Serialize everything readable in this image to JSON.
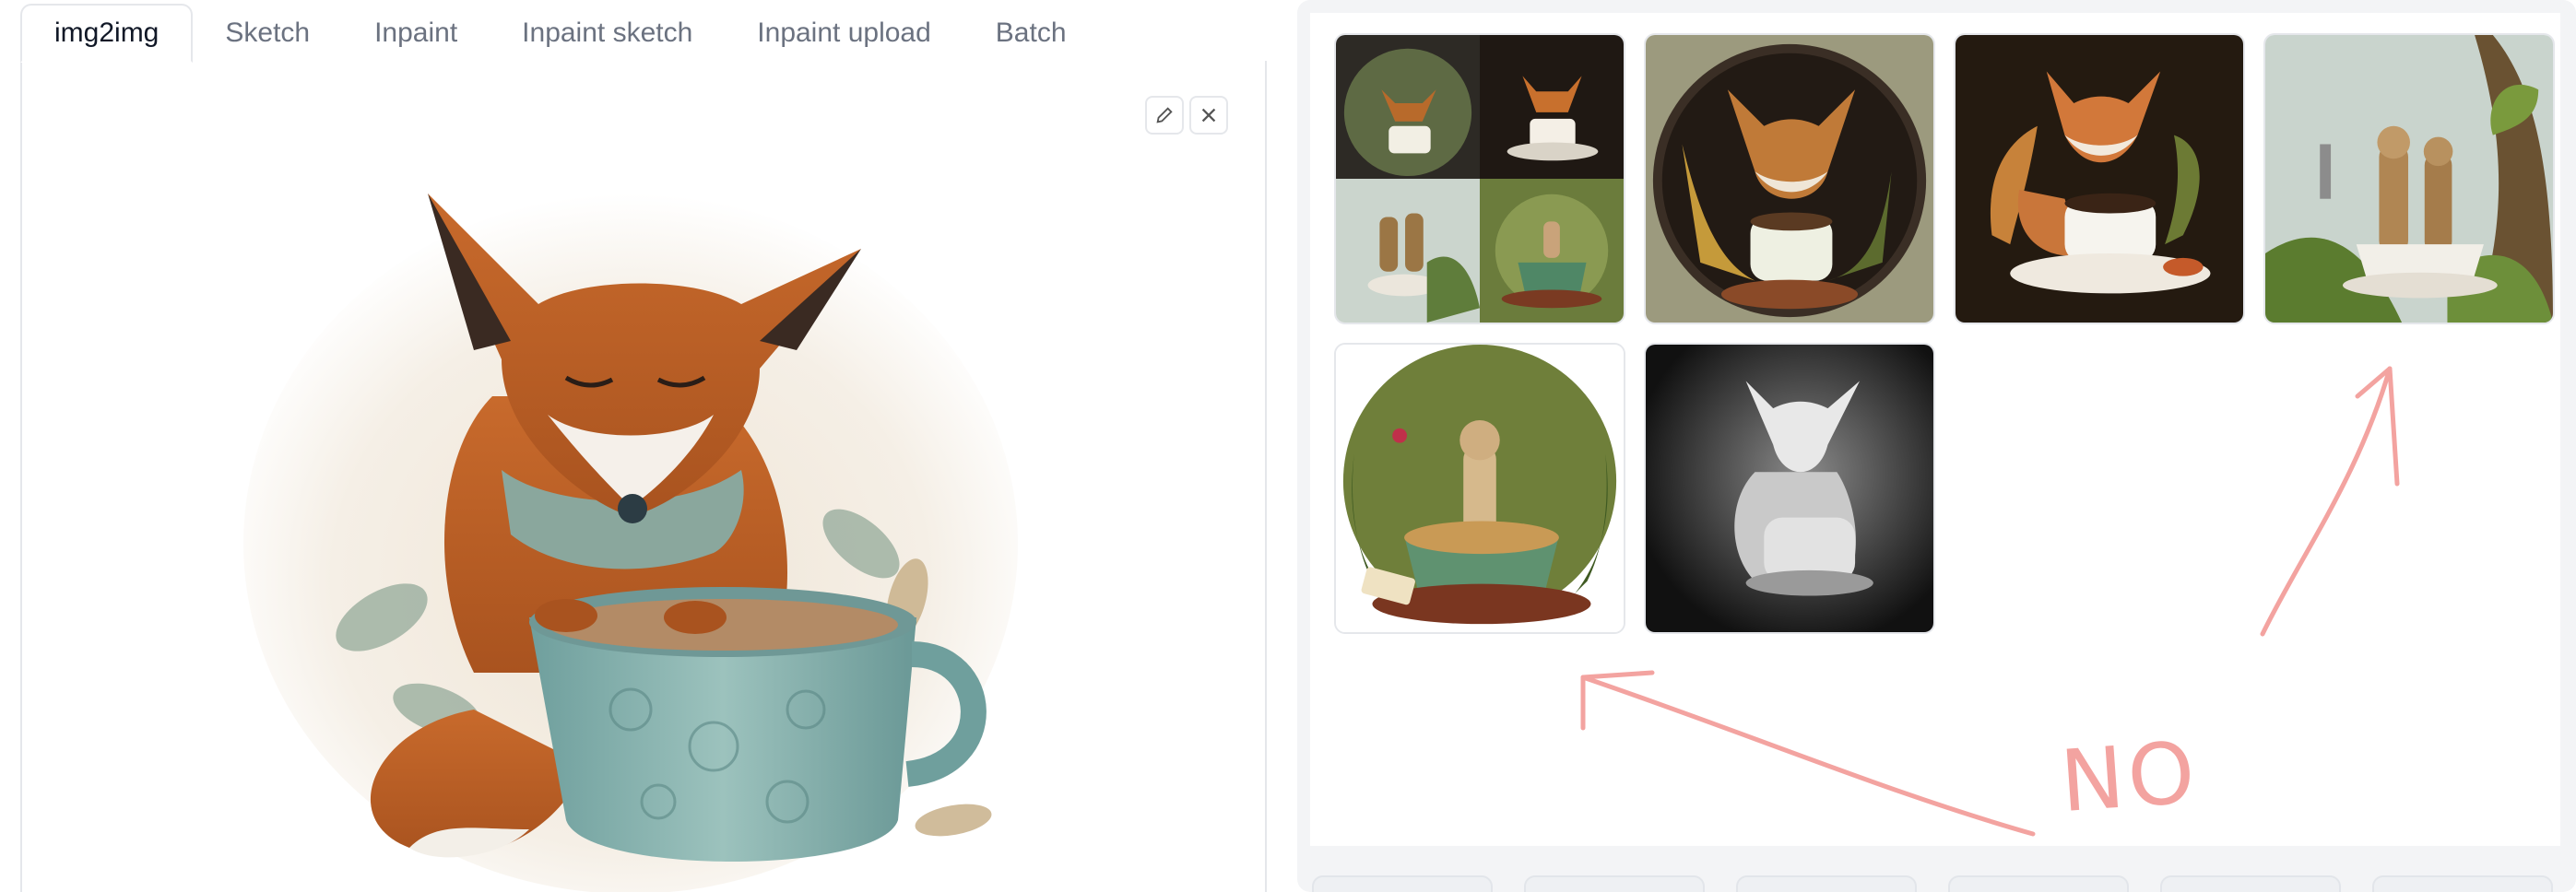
{
  "tabs": [
    {
      "label": "img2img",
      "active": true
    },
    {
      "label": "Sketch",
      "active": false
    },
    {
      "label": "Inpaint",
      "active": false
    },
    {
      "label": "Inpaint sketch",
      "active": false
    },
    {
      "label": "Inpaint upload",
      "active": false
    },
    {
      "label": "Batch",
      "active": false
    }
  ],
  "editor": {
    "image_subject": "fox sleeping on a teal coffee cup",
    "edit_icon": "pencil-icon",
    "clear_icon": "close-icon"
  },
  "gallery": {
    "items": [
      {
        "subject": "grid of four coffee animal images"
      },
      {
        "subject": "striped fox with coffee cup"
      },
      {
        "subject": "fox with coffee cup on dark background"
      },
      {
        "subject": "meerkats in a tea cup"
      },
      {
        "subject": "meerkat in a green coffee cup"
      },
      {
        "subject": "grayscale depth map of fox and cup"
      }
    ]
  },
  "annotation": {
    "text": "NO",
    "color": "#f3a3a0"
  },
  "colors": {
    "tab_active_text": "#111827",
    "tab_text": "#6b7280",
    "border": "#e5e7eb",
    "panel_bg": "#f3f4f6"
  }
}
